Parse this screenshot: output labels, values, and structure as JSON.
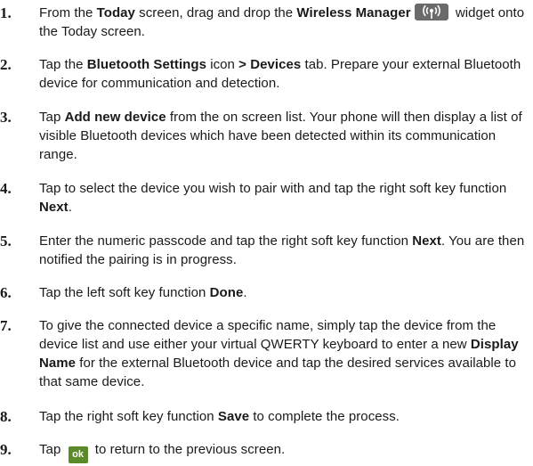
{
  "steps": [
    {
      "num": "1.",
      "parts": [
        {
          "t": "From the "
        },
        {
          "t": "Today",
          "b": true
        },
        {
          "t": " screen, drag and drop the "
        },
        {
          "t": "Wireless Manager",
          "b": true
        },
        {
          "icon": "wireless-manager-icon"
        },
        {
          "t": " widget onto the Today screen."
        }
      ]
    },
    {
      "num": "2.",
      "parts": [
        {
          "t": "Tap the "
        },
        {
          "t": "Bluetooth Settings",
          "b": true
        },
        {
          "t": " icon "
        },
        {
          "t": "> Devices",
          "b": true
        },
        {
          "t": " tab. Prepare your external Bluetooth device for communication and detection."
        }
      ]
    },
    {
      "num": "3.",
      "parts": [
        {
          "t": "Tap "
        },
        {
          "t": "Add new device",
          "b": true
        },
        {
          "t": " from the on screen list. Your phone will then display a list of visible Bluetooth devices which have been detected within its communication range."
        }
      ]
    },
    {
      "num": "4.",
      "parts": [
        {
          "t": "Tap to select the device you wish to pair with and tap the right soft key function "
        },
        {
          "t": "Next",
          "b": true
        },
        {
          "t": "."
        }
      ]
    },
    {
      "num": "5.",
      "parts": [
        {
          "t": "Enter the numeric passcode and tap the right soft key function "
        },
        {
          "t": "Next",
          "b": true
        },
        {
          "t": ". You are then notified the pairing is in progress."
        }
      ]
    },
    {
      "num": "6.",
      "parts": [
        {
          "t": "Tap the left soft key function "
        },
        {
          "t": "Done",
          "b": true
        },
        {
          "t": "."
        }
      ]
    },
    {
      "num": "7.",
      "parts": [
        {
          "t": "To give the connected device a specific name, simply tap the device from the device list and use either your virtual QWERTY keyboard to enter a new "
        },
        {
          "t": "Display Name",
          "b": true
        },
        {
          "t": " for the external Bluetooth device and tap the desired services available to that same device."
        }
      ]
    },
    {
      "num": "8.",
      "parts": [
        {
          "t": "Tap the right soft key function "
        },
        {
          "t": "Save",
          "b": true
        },
        {
          "t": " to complete the process."
        }
      ]
    },
    {
      "num": "9.",
      "parts": [
        {
          "t": "Tap "
        },
        {
          "icon": "ok-icon",
          "label": "ok"
        },
        {
          "t": " to return to the previous screen."
        }
      ]
    }
  ]
}
